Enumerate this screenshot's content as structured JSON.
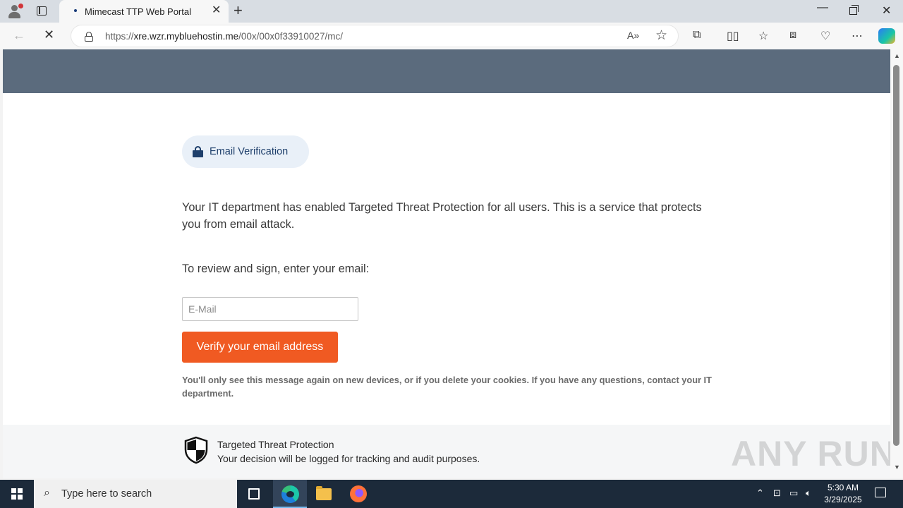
{
  "browser": {
    "tab_title": "Mimecast TTP Web Portal",
    "url_prefix": "https://",
    "url_host": "xre.wzr.mybluehostin.me",
    "url_path": "/00x/00x0f33910027/mc/"
  },
  "page": {
    "badge_label": "Email Verification",
    "intro_text": "Your IT department has enabled Targeted Threat Protection for all users. This is a service that protects you from email attack.",
    "prompt_text": "To review and sign, enter your email:",
    "email_placeholder": "E-Mail",
    "email_value": "",
    "verify_button": "Verify your email address",
    "note_text": "You'll only see this message again on new devices, or if you delete your cookies. If you have any questions, contact your IT department.",
    "footer_title": "Targeted Threat Protection",
    "footer_subtitle": "Your decision will be logged for tracking and audit purposes.",
    "watermark": "ANY RUN"
  },
  "taskbar": {
    "search_placeholder": "Type here to search",
    "time": "5:30 AM",
    "date": "3/29/2025"
  },
  "colors": {
    "banner": "#5b6b7d",
    "accent_button": "#f05a22",
    "badge_bg": "#e9f0f8",
    "badge_text": "#1e3f6b"
  }
}
